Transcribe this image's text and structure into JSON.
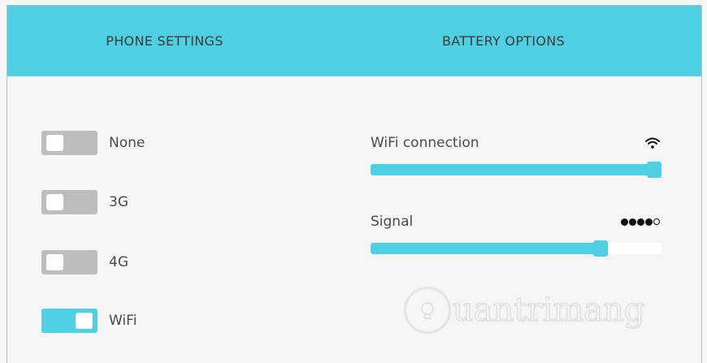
{
  "tabs": [
    {
      "label": "PHONE SETTINGS"
    },
    {
      "label": "BATTERY OPTIONS"
    }
  ],
  "network_toggles": [
    {
      "label": "None",
      "on": false
    },
    {
      "label": "3G",
      "on": false
    },
    {
      "label": "4G",
      "on": false
    },
    {
      "label": "WiFi",
      "on": true
    }
  ],
  "wifi": {
    "label": "WiFi connection",
    "icon": "wifi-icon",
    "level_percent": 100
  },
  "signal": {
    "label": "Signal",
    "icon": "signal-dots-icon",
    "dots_filled": 4,
    "dots_total": 5,
    "level_percent": 79
  },
  "watermark": {
    "text": "uantrimang"
  },
  "colors": {
    "accent": "#4fd0e2",
    "toggle_off": "#bdbdbd",
    "background": "#f5f5f5"
  }
}
